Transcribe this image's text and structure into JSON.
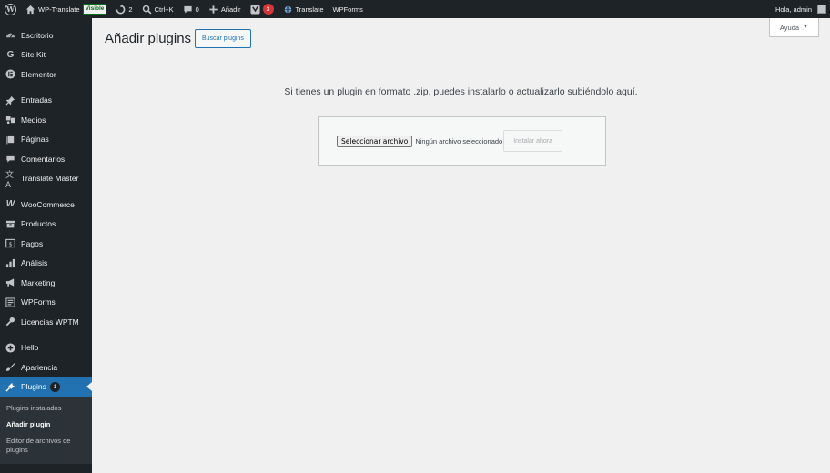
{
  "adminbar": {
    "site_name": "WP-Translate",
    "visible_badge": "Visible",
    "updates_count": "2",
    "search_shortcut": "Ctrl+K",
    "comments_count": "0",
    "new_label": "Añadir",
    "yoast_count": "3",
    "translate_label": "Translate",
    "wpforms_label": "WPForms",
    "greeting": "Hola, admin"
  },
  "sidebar": {
    "items": [
      {
        "label": "Escritorio",
        "icon": "dashboard-icon"
      },
      {
        "label": "Site Kit",
        "icon": "google-icon"
      },
      {
        "label": "Elementor",
        "icon": "elementor-icon"
      },
      {
        "label": "Entradas",
        "icon": "pin-icon"
      },
      {
        "label": "Medios",
        "icon": "media-icon"
      },
      {
        "label": "Páginas",
        "icon": "pages-icon"
      },
      {
        "label": "Comentarios",
        "icon": "comment-icon"
      },
      {
        "label": "Translate Master",
        "icon": "translate-icon"
      },
      {
        "label": "WooCommerce",
        "icon": "woocommerce-icon"
      },
      {
        "label": "Productos",
        "icon": "archive-icon"
      },
      {
        "label": "Pagos",
        "icon": "money-icon"
      },
      {
        "label": "Análisis",
        "icon": "bar-chart-icon"
      },
      {
        "label": "Marketing",
        "icon": "megaphone-icon"
      },
      {
        "label": "WPForms",
        "icon": "form-icon"
      },
      {
        "label": "Licencias WPTM",
        "icon": "key-icon"
      },
      {
        "label": "Hello",
        "icon": "plus-circle-icon"
      },
      {
        "label": "Apariencia",
        "icon": "brush-icon"
      },
      {
        "label": "Plugins",
        "icon": "plug-icon",
        "badge": "1"
      }
    ],
    "submenu": [
      {
        "label": "Plugins instalados"
      },
      {
        "label": "Añadir plugin"
      },
      {
        "label": "Editor de archivos de plugins"
      }
    ]
  },
  "main": {
    "help_label": "Ayuda",
    "page_title": "Añadir plugins",
    "search_button": "Buscar plugins",
    "upload_help": "Si tienes un plugin en formato .zip, puedes instalarlo o actualizarlo subiéndolo aquí.",
    "file_button": "Seleccionar archivo",
    "file_status": "Ningún archivo seleccionado",
    "install_button": "Instalar ahora"
  },
  "colors": {
    "adminbar_bg": "#1d2327",
    "accent": "#2271b1",
    "page_bg": "#f0f0f1",
    "badge_red": "#d63638"
  }
}
